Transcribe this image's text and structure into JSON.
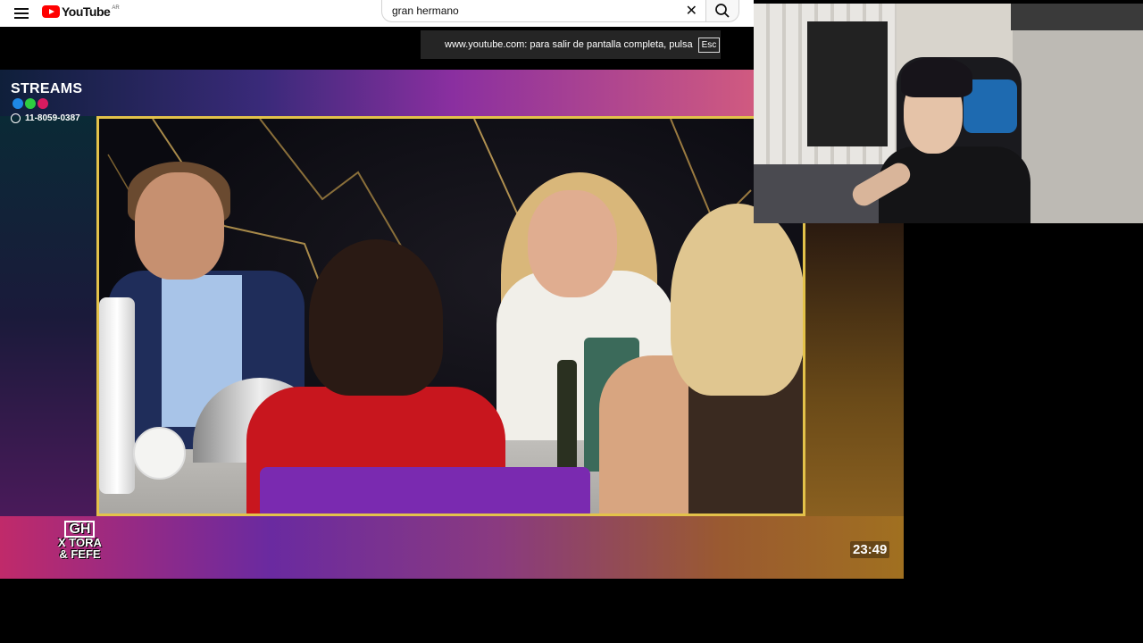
{
  "youtube": {
    "logo_text": "YouTube",
    "country_code": "AR",
    "search": {
      "query": "gran hermano"
    }
  },
  "fullscreen_notice": {
    "text": "www.youtube.com: para salir de pantalla completa, pulsa",
    "key": "Esc"
  },
  "stream": {
    "brand": "STREAMS",
    "phone": "11-8059-0387",
    "show_logo": {
      "line1": "GH",
      "line2": "X TORA",
      "line3": "& FEFE"
    },
    "clock": "23:49"
  },
  "colors": {
    "frame_border": "#e3c24a",
    "youtube_red": "#ff0000",
    "dot_blue": "#1e88e5",
    "dot_green": "#2ecc40",
    "dot_pink": "#d81b60"
  },
  "icons": {
    "menu": "hamburger-icon",
    "clear": "close-icon",
    "search": "search-icon",
    "whatsapp": "whatsapp-icon"
  }
}
